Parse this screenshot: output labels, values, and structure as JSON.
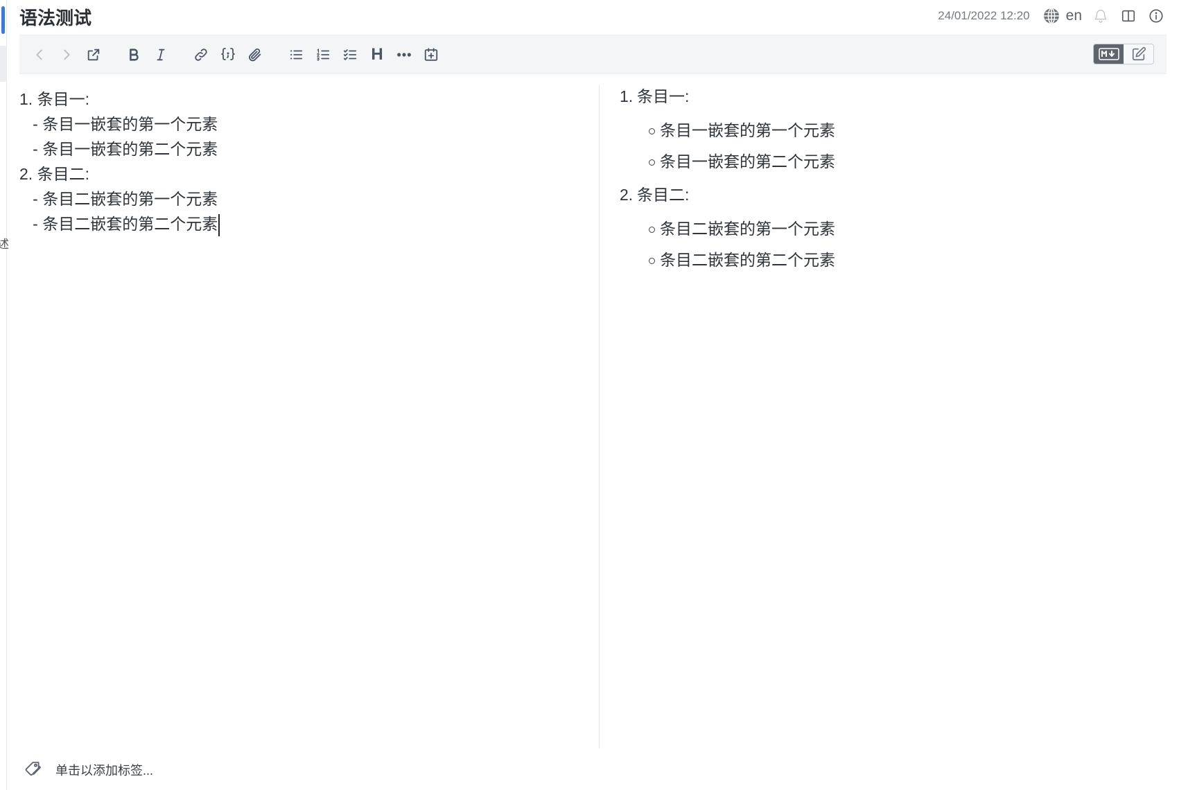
{
  "note": {
    "title": "语法测试",
    "timestamp": "24/01/2022 12:20",
    "language": "en"
  },
  "sidebar_fragment": "述",
  "toolbar": {
    "buttons": [
      {
        "name": "back-button",
        "icon": "chevron-left-icon",
        "enabled": false
      },
      {
        "name": "forward-button",
        "icon": "chevron-right-icon",
        "enabled": false
      },
      {
        "name": "open-external-button",
        "icon": "external-link-icon",
        "enabled": true
      },
      {
        "name": "bold-button",
        "icon": "bold-icon",
        "enabled": true
      },
      {
        "name": "italic-button",
        "icon": "italic-icon",
        "enabled": true
      },
      {
        "name": "link-button",
        "icon": "link-icon",
        "enabled": true
      },
      {
        "name": "code-button",
        "icon": "code-braces-icon",
        "enabled": true
      },
      {
        "name": "attach-button",
        "icon": "paperclip-icon",
        "enabled": true
      },
      {
        "name": "bullet-list-button",
        "icon": "bullet-list-icon",
        "enabled": true
      },
      {
        "name": "numbered-list-button",
        "icon": "numbered-list-icon",
        "enabled": true
      },
      {
        "name": "checklist-button",
        "icon": "checklist-icon",
        "enabled": true
      },
      {
        "name": "heading-button",
        "icon": "heading-icon",
        "enabled": true
      },
      {
        "name": "horizontal-rule-button",
        "icon": "ellipsis-icon",
        "enabled": true
      },
      {
        "name": "insert-date-button",
        "icon": "calendar-plus-icon",
        "enabled": true
      }
    ],
    "heading_glyph": "H",
    "mode_switch": {
      "markdown_label": "M↓",
      "active": "markdown"
    }
  },
  "editor": {
    "lines": [
      "1. 条目一:",
      "   - 条目一嵌套的第一个元素",
      "   - 条目一嵌套的第二个元素",
      "2. 条目二:",
      "   - 条目二嵌套的第一个元素",
      "   - 条目二嵌套的第二个元素"
    ]
  },
  "preview": {
    "items": [
      {
        "number": "1.",
        "label": "条目一:",
        "children": [
          "条目一嵌套的第一个元素",
          "条目一嵌套的第二个元素"
        ]
      },
      {
        "number": "2.",
        "label": "条目二:",
        "children": [
          "条目二嵌套的第一个元素",
          "条目二嵌套的第二个元素"
        ]
      }
    ]
  },
  "tags": {
    "placeholder": "单击以添加标签..."
  }
}
